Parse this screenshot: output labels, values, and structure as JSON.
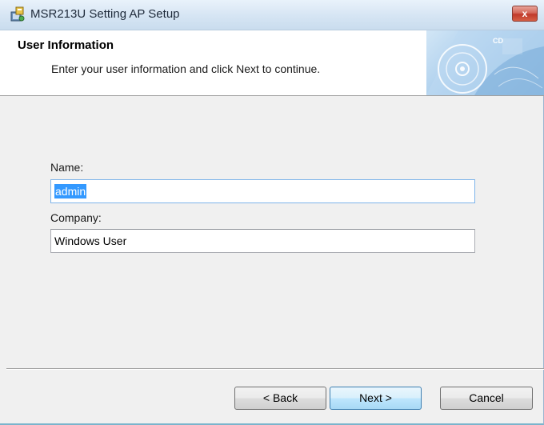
{
  "window": {
    "title": "MSR213U Setting AP Setup",
    "close_label": "x"
  },
  "header": {
    "title": "User Information",
    "subtitle": "Enter your user information and click Next to continue.",
    "banner_text": "CD"
  },
  "form": {
    "name_label": "Name:",
    "name_value": "admin",
    "company_label": "Company:",
    "company_value": "Windows User"
  },
  "buttons": {
    "back": "< Back",
    "next": "Next >",
    "cancel": "Cancel"
  },
  "colors": {
    "selection": "#3399ff",
    "close_button": "#c0392b",
    "default_button_border": "#3c7fb1"
  }
}
